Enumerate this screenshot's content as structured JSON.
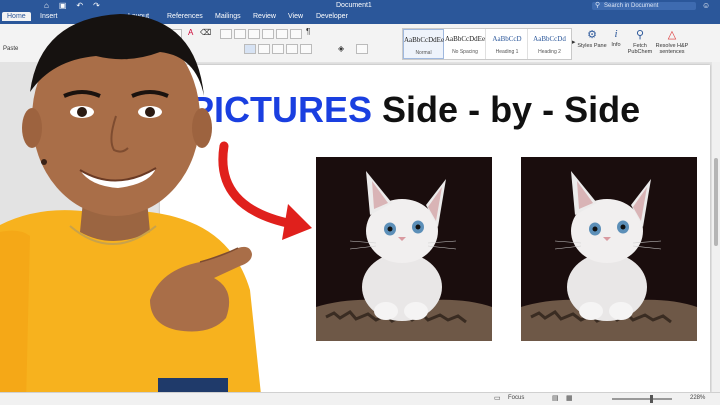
{
  "window": {
    "title": "Document1"
  },
  "search": {
    "placeholder": "Search in Document"
  },
  "tabs": [
    {
      "label": "Home"
    },
    {
      "label": "Insert"
    },
    {
      "label": "Layout"
    },
    {
      "label": "References"
    },
    {
      "label": "Mailings"
    },
    {
      "label": "Review"
    },
    {
      "label": "View"
    },
    {
      "label": "Developer"
    }
  ],
  "ribbon": {
    "paste_label": "Paste",
    "styles": [
      {
        "preview": "AaBbCcDdEe",
        "name": "Normal"
      },
      {
        "preview": "AaBbCcDdEe",
        "name": "No Spacing"
      },
      {
        "preview": "AaBbCcD",
        "name": "Heading 1"
      },
      {
        "preview": "AaBbCcDd",
        "name": "Heading 2"
      }
    ],
    "tools": [
      {
        "label": "Styles Pane",
        "icon": "styles-pane-icon",
        "glyph": "⚙"
      },
      {
        "label": "Info",
        "icon": "info-icon",
        "glyph": "i"
      },
      {
        "label": "Fetch PubChem",
        "icon": "pubchem-icon",
        "glyph": "⚲"
      },
      {
        "label": "Resolve H&P sentences",
        "icon": "warning-icon",
        "glyph": "△"
      }
    ]
  },
  "document": {
    "heading_blue": "PICTURES",
    "heading_black": "Side - by - Side"
  },
  "status": {
    "focus_label": "Focus",
    "zoom": "228%"
  },
  "colors": {
    "word_blue": "#2b579a",
    "heading_blue": "#1a3fe0",
    "arrow_red": "#e0201c",
    "shirt_yellow": "#f7b21e"
  }
}
